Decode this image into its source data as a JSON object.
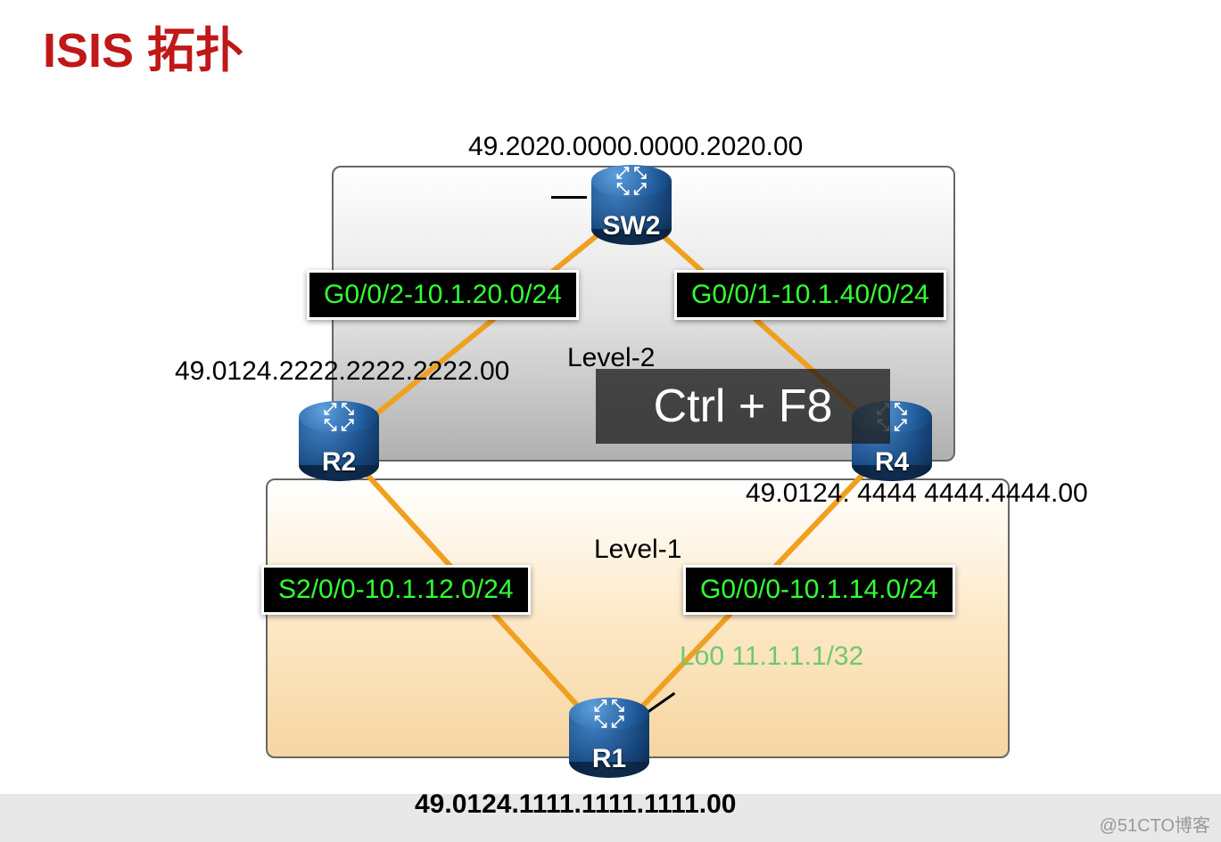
{
  "title": "ISIS 拓扑",
  "areas": {
    "level2_label": "Level-2",
    "level1_label": "Level-1"
  },
  "nodes": {
    "sw2": {
      "name": "SW2",
      "net": "49.2020.0000.0000.2020.00"
    },
    "r2": {
      "name": "R2",
      "net": "49.0124.2222.2222.2222.00"
    },
    "r4": {
      "name": "R4",
      "net": "49.0124. 4444 4444.4444.00"
    },
    "r1": {
      "name": "R1",
      "net": "49.0124.1111.1111.1111.00"
    }
  },
  "links": {
    "sw2_r2": "G0/0/2-10.1.20.0/24",
    "sw2_r4": "G0/0/1-10.1.40/0/24",
    "r2_r1": "S2/0/0-10.1.12.0/24",
    "r4_r1": "G0/0/0-10.1.14.0/24"
  },
  "loopback": "Lo0 11.1.1.1/32",
  "overlay": "Ctrl + F8",
  "watermark": "@51CTO博客"
}
